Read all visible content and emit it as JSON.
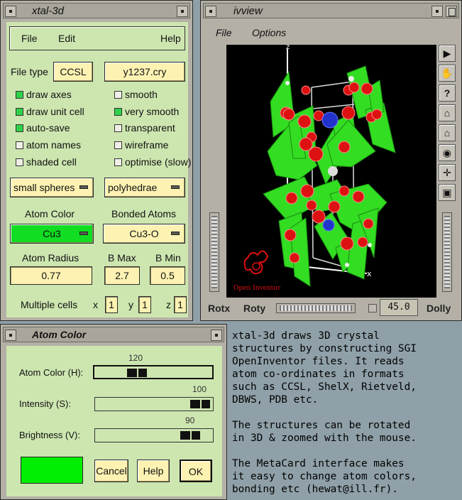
{
  "xtal": {
    "title": "xtal-3d",
    "menu": {
      "file": "File",
      "edit": "Edit",
      "help": "Help"
    },
    "file_type_label": "File type",
    "file_type_value": "CCSL",
    "filename": "y1237.cry",
    "checks": [
      {
        "label": "draw axes",
        "on": true
      },
      {
        "label": "smooth",
        "on": false
      },
      {
        "label": "draw unit cell",
        "on": true
      },
      {
        "label": "very smooth",
        "on": true
      },
      {
        "label": "auto-save",
        "on": true
      },
      {
        "label": "transparent",
        "on": false
      },
      {
        "label": "atom names",
        "on": false
      },
      {
        "label": "wireframe",
        "on": false
      },
      {
        "label": "shaded cell",
        "on": false
      },
      {
        "label": "optimise (slow)",
        "on": false
      }
    ],
    "sphere_mode": "small spheres",
    "draw_mode": "polyhedrae",
    "atom_color_label": "Atom Color",
    "bonded_atoms_label": "Bonded Atoms",
    "atom_color_value": "Cu3",
    "bonded_value": "Cu3-O",
    "atom_radius_label": "Atom Radius",
    "bmax_label": "B Max",
    "bmin_label": "B Min",
    "atom_radius": "0.77",
    "bmax": "2.7",
    "bmin": "0.5",
    "multiple_cells_label": "Multiple cells",
    "x_label": "x",
    "y_label": "y",
    "z_label": "z",
    "cells_x": "1",
    "cells_y": "1",
    "cells_z": "1"
  },
  "ivview": {
    "title": "ivview",
    "menu": {
      "file": "File",
      "options": "Options"
    },
    "logo_text": "Open Inventor",
    "axis_z": "z",
    "axis_x": "x",
    "rotx_label": "Rotx",
    "roty_label": "Roty",
    "zoom_value": "45.0",
    "dolly_label": "Dolly",
    "side_icons": [
      "arrow-pointer-icon",
      "hand-icon",
      "help-icon",
      "home-icon",
      "set-home-icon",
      "view-all-icon",
      "seek-icon",
      "perspective-icon"
    ]
  },
  "atomcolor": {
    "title": "Atom Color",
    "hue_label": "Atom Color (H):",
    "sat_label": "Intensity (S):",
    "val_label": "Brightness (V):",
    "hue_value": "120",
    "sat_value": "100",
    "val_value": "90",
    "hue_fraction": 0.33,
    "sat_fraction": 1.0,
    "val_fraction": 0.9,
    "swatch_color": "#00ee00",
    "cancel_label": "Cancel",
    "help_label": "Help",
    "ok_label": "OK"
  },
  "description": {
    "p1": [
      "xtal-3d draws 3D crystal",
      "structures by constructing SGI",
      "OpenInventor files. It reads",
      "atom co-ordinates in formats",
      "such as CCSL, ShelX, Rietveld,",
      "DBWS, PDB etc."
    ],
    "p2": [
      "The structures can be rotated",
      "in 3D & zoomed with the mouse."
    ],
    "p3": [
      "The MetaCard interface makes",
      "it easy to change atom colors,",
      "bonding etc (hewat@ill.fr)."
    ]
  },
  "colors": {
    "panel_green": "#cde6b0",
    "field_yellow": "#fdf2b2",
    "checkbox_on": "#2fd14a",
    "polyhedra": "#33dd22",
    "atom_red": "#dd1111",
    "atom_blue": "#2233cc"
  }
}
